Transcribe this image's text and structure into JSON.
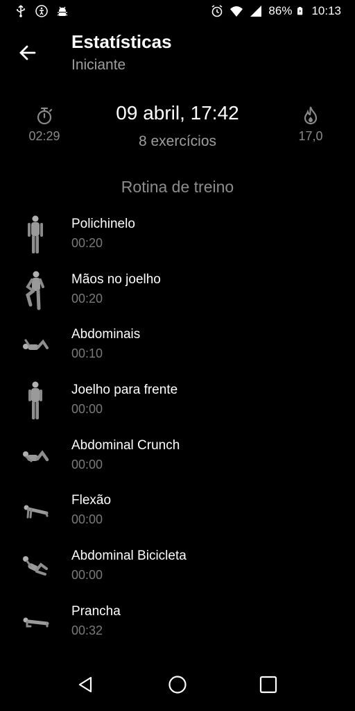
{
  "status_bar": {
    "left_icons": [
      "usb-icon",
      "accessibility-icon",
      "android-debug-icon"
    ],
    "right_icons": [
      "alarm-icon",
      "wifi-icon",
      "signal-icon",
      "battery-charging-icon"
    ],
    "battery": "86%",
    "time": "10:13"
  },
  "header": {
    "back_icon": "arrow-back-icon",
    "title": "Estatísticas",
    "subtitle": "Iniciante"
  },
  "summary": {
    "timer_icon": "stopwatch-icon",
    "duration": "02:29",
    "date": "09 abril, 17:42",
    "exercise_count": "8 exercícios",
    "calorie_icon": "flame-icon",
    "calories": "17,0"
  },
  "routine": {
    "title": "Rotina de treino",
    "exercises": [
      {
        "name": "Polichinelo",
        "time": "00:20",
        "pose": "standing"
      },
      {
        "name": "Mãos no joelho",
        "time": "00:20",
        "pose": "knee"
      },
      {
        "name": "Abdominais",
        "time": "00:10",
        "pose": "lying"
      },
      {
        "name": "Joelho para frente",
        "time": "00:00",
        "pose": "standing"
      },
      {
        "name": "Abdominal Crunch",
        "time": "00:00",
        "pose": "lying"
      },
      {
        "name": "Flexão",
        "time": "00:00",
        "pose": "pushup"
      },
      {
        "name": "Abdominal Bicicleta",
        "time": "00:00",
        "pose": "bicycle"
      },
      {
        "name": "Prancha",
        "time": "00:32",
        "pose": "plank"
      }
    ]
  },
  "nav_bar": {
    "icons": [
      "back-triangle-icon",
      "home-circle-icon",
      "recents-square-icon"
    ]
  },
  "colors": {
    "background": "#000000",
    "primary_text": "#ffffff",
    "secondary_text": "#9e9e9e"
  }
}
